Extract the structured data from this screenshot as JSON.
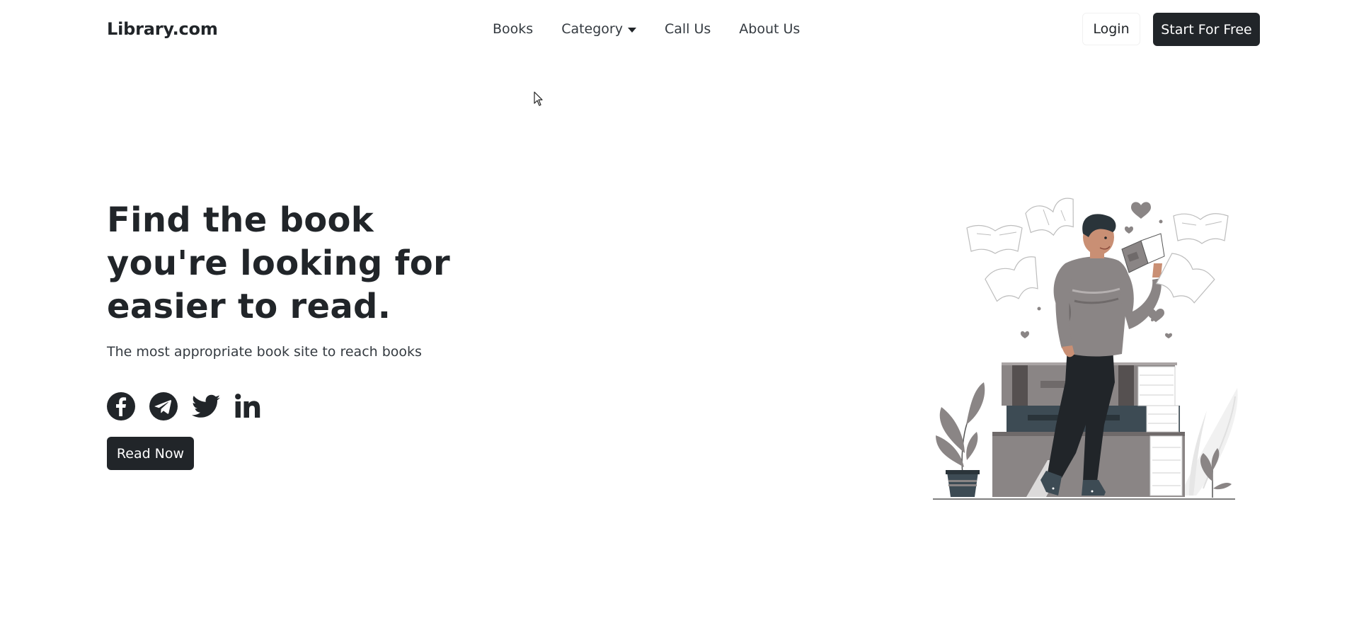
{
  "nav": {
    "brand": "Library.com",
    "links": [
      {
        "label": "Books"
      },
      {
        "label": "Category",
        "has_dropdown": true
      },
      {
        "label": "Call Us"
      },
      {
        "label": "About Us"
      }
    ],
    "login_label": "Login",
    "start_label": "Start For Free"
  },
  "hero": {
    "title": "Find the book you're looking for easier to read.",
    "subtitle": "The most appropriate book site to reach books",
    "socials": [
      {
        "icon": "facebook-icon"
      },
      {
        "icon": "telegram-icon"
      },
      {
        "icon": "twitter-icon"
      },
      {
        "icon": "linkedin-icon"
      }
    ],
    "read_label": "Read Now"
  },
  "illustration": {
    "icon": "man-reading-book-illustration"
  },
  "colors": {
    "primary_dark": "#212529",
    "text": "#343a40",
    "illustration_gray": "#8a8585",
    "illustration_slate": "#3d4b54",
    "background": "#ffffff"
  }
}
